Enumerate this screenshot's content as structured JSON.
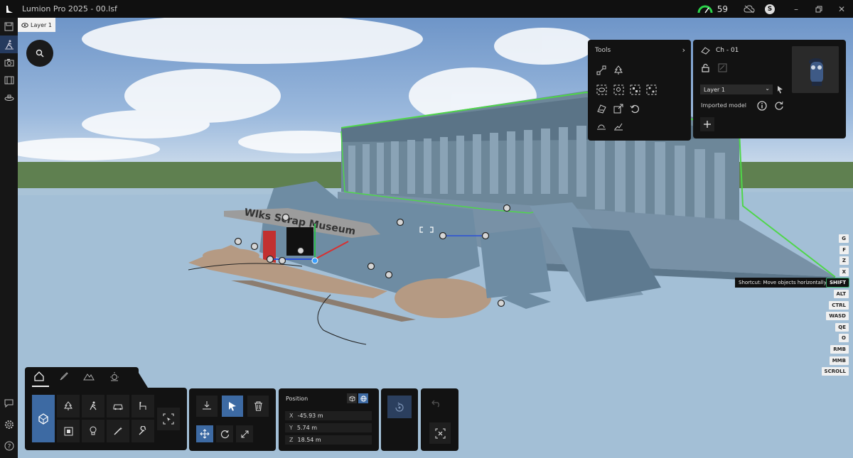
{
  "app": {
    "title": "Lumion Pro 2025 - 00.lsf",
    "fps": "59",
    "user_initial": "S"
  },
  "viewport": {
    "layer_chip": "Layer 1",
    "building_sign": "Wlks Scrap Museum",
    "tooltip": "Shortcut: Move objects horizontally"
  },
  "tools_panel": {
    "title": "Tools"
  },
  "object_panel": {
    "name": "Ch - 01",
    "layer": "Layer 1",
    "imported_label": "Imported model"
  },
  "shortcut_keys": [
    "G",
    "F",
    "Z",
    "X",
    "SHIFT",
    "ALT",
    "CTRL",
    "WASD",
    "QE",
    "O",
    "RMB",
    "MMB",
    "SCROLL"
  ],
  "active_key": "SHIFT",
  "position_panel": {
    "title": "Position",
    "x_label": "X",
    "x": "-45.93 m",
    "y_label": "Y",
    "y": "5.74 m",
    "z_label": "Z",
    "z": "18.54 m"
  },
  "colors": {
    "accent": "#3d6aa3",
    "selection": "#4fd64a",
    "panel": "#121212"
  }
}
